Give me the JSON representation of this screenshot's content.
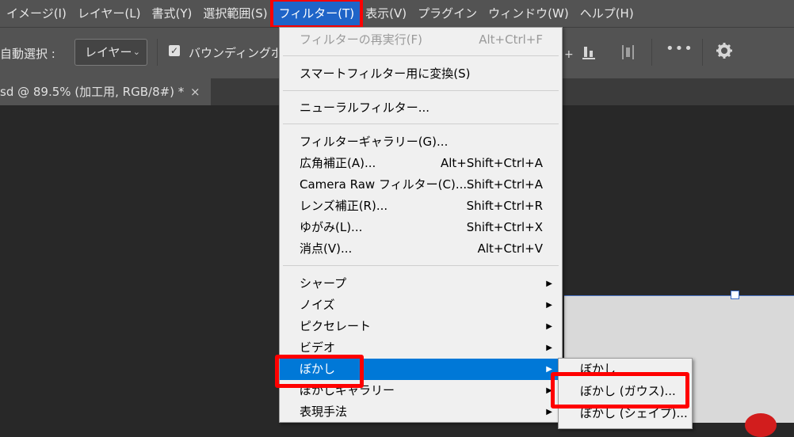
{
  "menubar": {
    "items": [
      {
        "label": "イメージ(I)"
      },
      {
        "label": "レイヤー(L)"
      },
      {
        "label": "書式(Y)"
      },
      {
        "label": "選択範囲(S)"
      },
      {
        "label": "フィルター(T)"
      },
      {
        "label": "表示(V)"
      },
      {
        "label": "プラグイン"
      },
      {
        "label": "ウィンドウ(W)"
      },
      {
        "label": "ヘルプ(H)"
      }
    ]
  },
  "options": {
    "auto_select_label": "自動選択 :",
    "select_value": "レイヤー",
    "bounding_label": "バウンディングボ",
    "more_label": "•••"
  },
  "tab": {
    "title": "sd @ 89.5% (加工用, RGB/8#) *",
    "close": "×"
  },
  "filter_menu": {
    "items": [
      {
        "label": "フィルターの再実行(F)",
        "shortcut": "Alt+Ctrl+F"
      },
      {
        "label": "スマートフィルター用に変換(S)"
      },
      {
        "label": "ニューラルフィルター..."
      },
      {
        "label": "フィルターギャラリー(G)..."
      },
      {
        "label": "広角補正(A)...",
        "shortcut": "Alt+Shift+Ctrl+A"
      },
      {
        "label": "Camera Raw フィルター(C)...",
        "shortcut": "Shift+Ctrl+A"
      },
      {
        "label": "レンズ補正(R)...",
        "shortcut": "Shift+Ctrl+R"
      },
      {
        "label": "ゆがみ(L)...",
        "shortcut": "Shift+Ctrl+X"
      },
      {
        "label": "消点(V)...",
        "shortcut": "Alt+Ctrl+V"
      },
      {
        "label": "シャープ"
      },
      {
        "label": "ノイズ"
      },
      {
        "label": "ピクセレート"
      },
      {
        "label": "ビデオ"
      },
      {
        "label": "ぼかし"
      },
      {
        "label": "ぼかしギャラリー"
      },
      {
        "label": "表現手法"
      }
    ]
  },
  "blur_submenu": {
    "items": [
      {
        "label": "ぼかし"
      },
      {
        "label": "ぼかし (ガウス)..."
      },
      {
        "label": "ぼかし (シェイプ)..."
      }
    ]
  },
  "colors": {
    "menu_highlight": "#0078d7",
    "annotation_red": "#ff0000"
  }
}
